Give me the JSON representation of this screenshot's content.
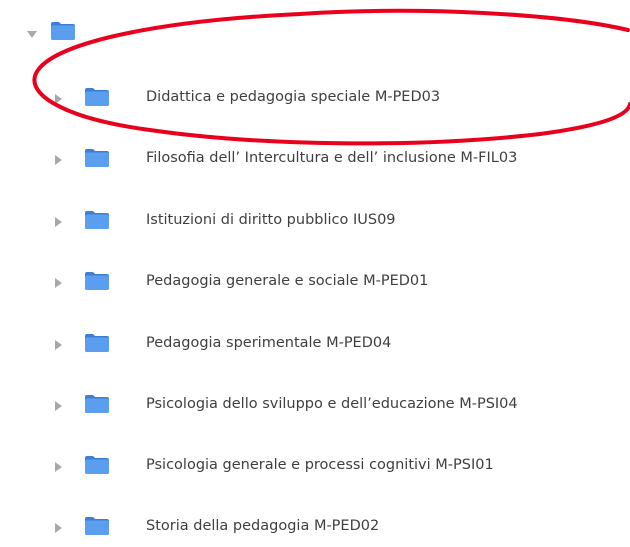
{
  "tree": {
    "root": {
      "expanded": true,
      "label": ""
    },
    "items": [
      {
        "label": "Didattica e pedagogia speciale M-PED03",
        "expanded": false,
        "highlighted": true
      },
      {
        "label": "Filosofia dell’ Intercultura e dell’ inclusione M-FIL03",
        "expanded": false
      },
      {
        "label": "Istituzioni di diritto pubblico IUS09",
        "expanded": false
      },
      {
        "label": "Pedagogia generale e sociale M-PED01",
        "expanded": false
      },
      {
        "label": "Pedagogia sperimentale M-PED04",
        "expanded": false
      },
      {
        "label": "Psicologia dello sviluppo e dell’educazione M-PSI04",
        "expanded": false
      },
      {
        "label": "Psicologia generale e processi cognitivi M-PSI01",
        "expanded": false
      },
      {
        "label": "Storia della pedagogia M-PED02",
        "expanded": false
      }
    ]
  },
  "colors": {
    "folder_fill": "#4a90e2",
    "folder_tab": "#3b7fd6",
    "toggle_arrow": "#a8a8a8",
    "label_text": "#3f3f3f",
    "highlight_ring": "#e8001c"
  },
  "icons": {
    "collapsed_toggle": "triangle-right-icon",
    "expanded_toggle": "triangle-down-icon",
    "folder": "folder-icon"
  }
}
